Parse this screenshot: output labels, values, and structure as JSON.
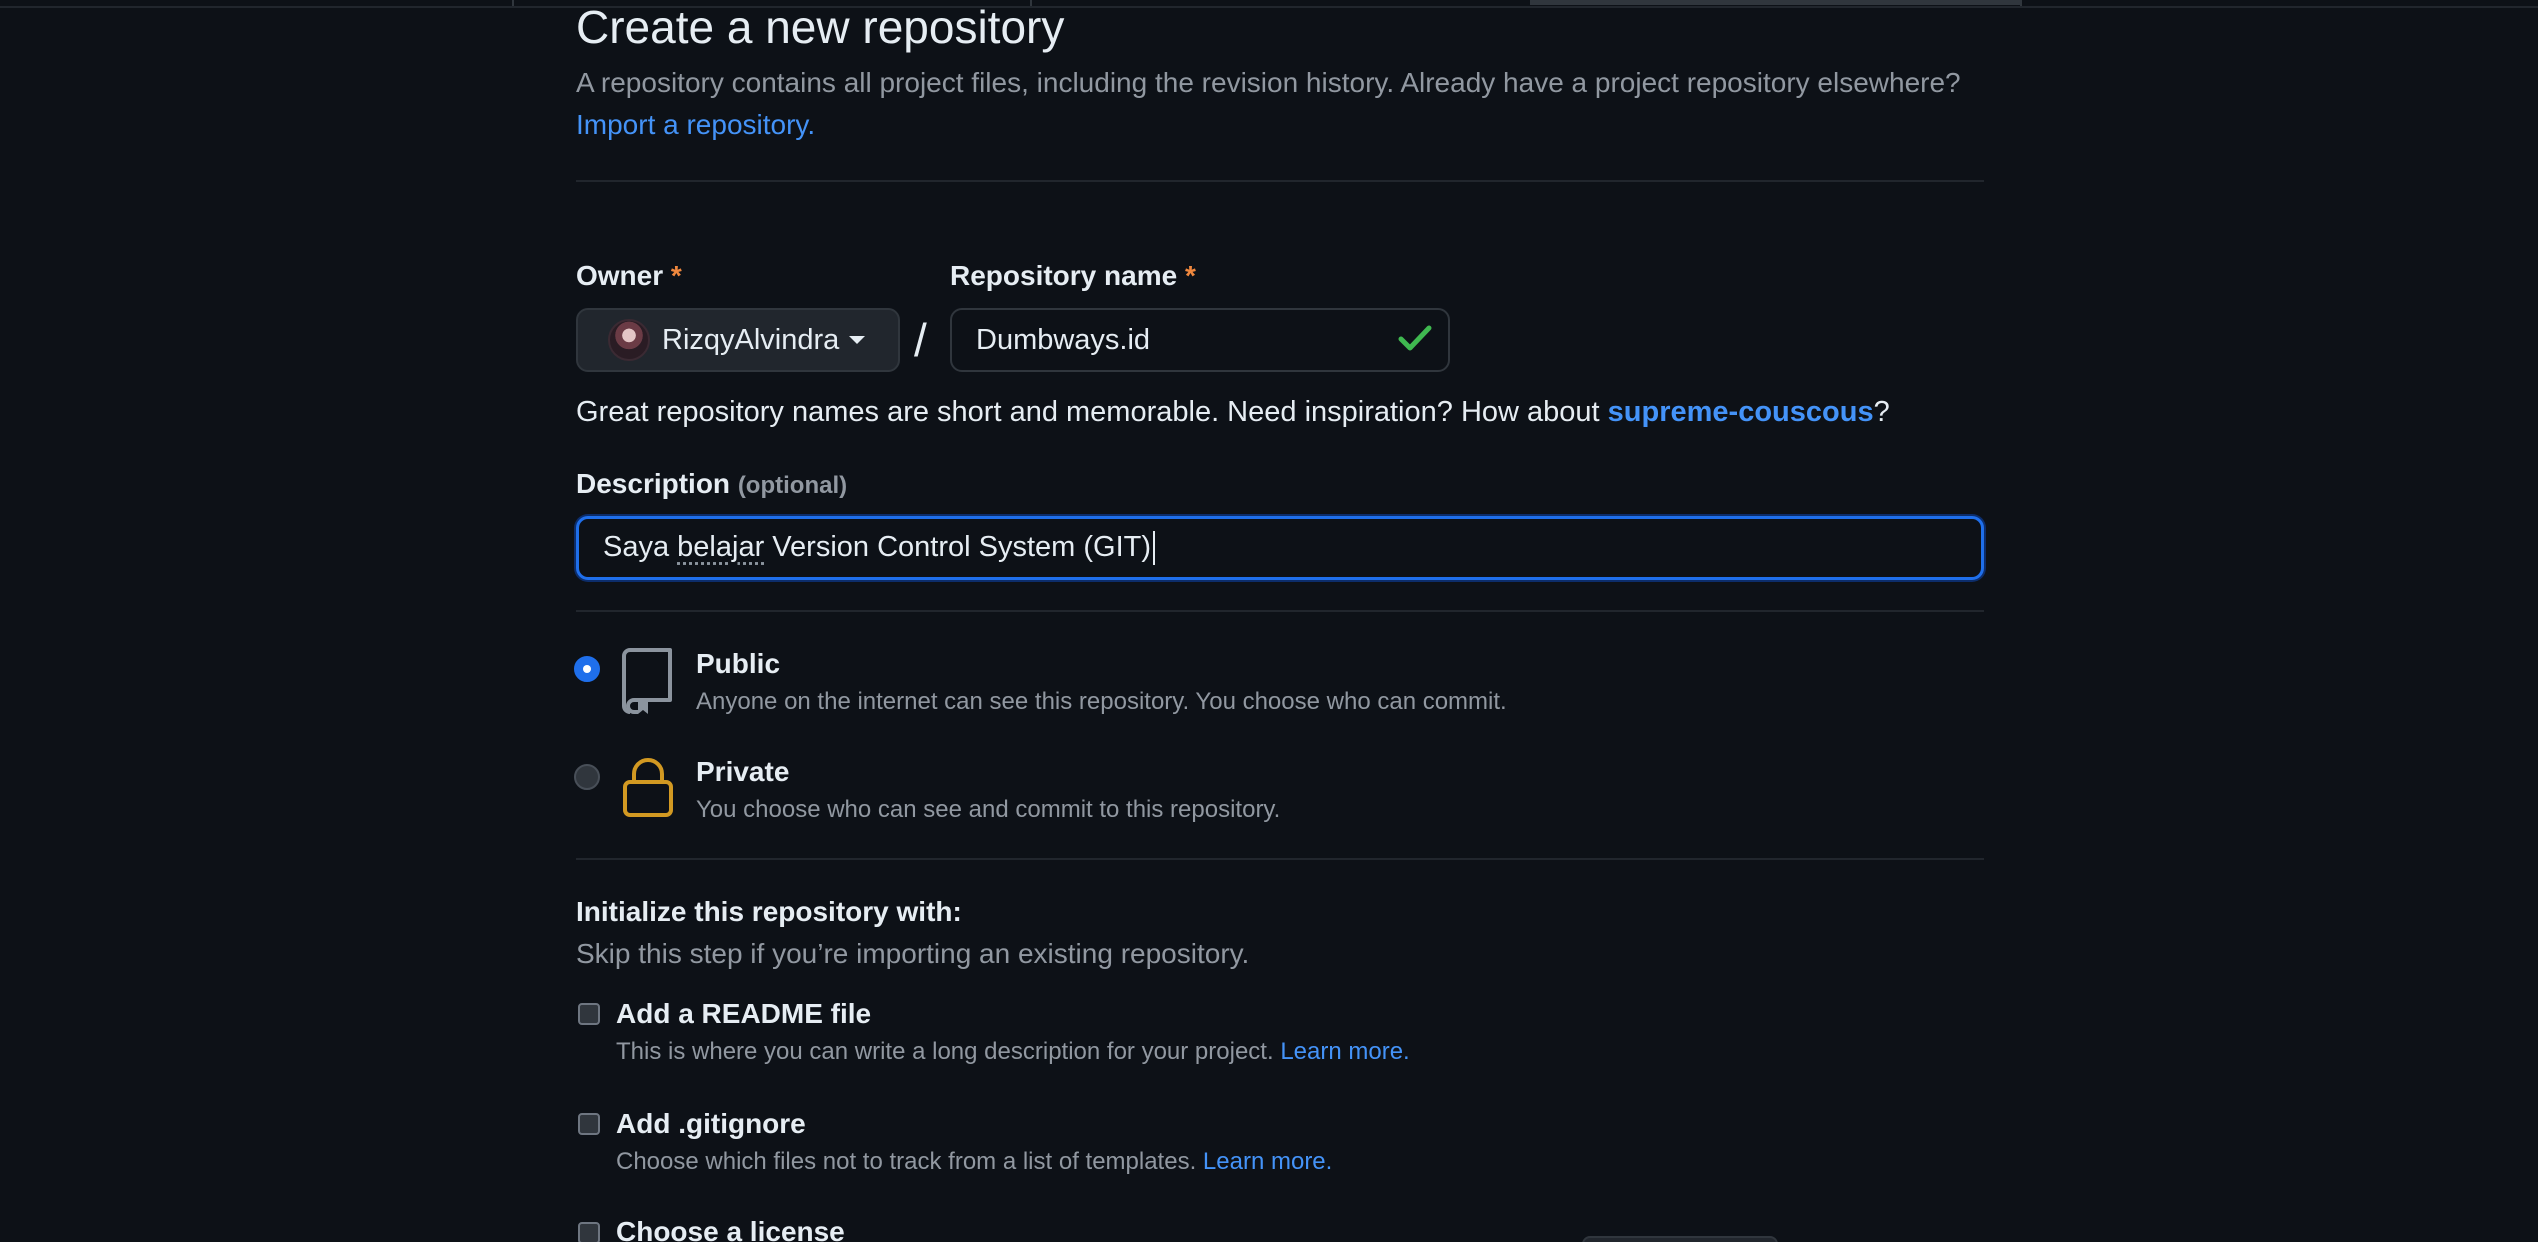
{
  "page": {
    "title": "Create a new repository",
    "subtitle_text": "A repository contains all project files, including the revision history. Already have a project repository elsewhere?",
    "import_link": "Import a repository."
  },
  "owner": {
    "label": "Owner",
    "required_mark": "*",
    "value": "RizqyAlvindra"
  },
  "repo_name": {
    "label": "Repository name",
    "required_mark": "*",
    "value": "Dumbways.id",
    "separator": "/"
  },
  "name_hint": {
    "text": "Great repository names are short and memorable. Need inspiration? How about",
    "suggestion": "supreme-couscous",
    "suffix": "?"
  },
  "description": {
    "label": "Description",
    "optional": "(optional)",
    "value_part1": "Saya ",
    "value_misspelled": "belajar",
    "value_part2": " Version Control System (GIT)"
  },
  "visibility": {
    "public": {
      "title": "Public",
      "desc": "Anyone on the internet can see this repository. You choose who can commit.",
      "selected": true,
      "icon": "repo-icon"
    },
    "private": {
      "title": "Private",
      "desc": "You choose who can see and commit to this repository.",
      "selected": false,
      "icon": "lock-icon"
    }
  },
  "initialize": {
    "title": "Initialize this repository with:",
    "subtitle": "Skip this step if you’re importing an existing repository.",
    "options": [
      {
        "title": "Add a README file",
        "desc": "This is where you can write a long description for your project.",
        "link": "Learn more.",
        "checked": false
      },
      {
        "title": "Add .gitignore",
        "desc": "Choose which files not to track from a list of templates.",
        "link": "Learn more.",
        "checked": false
      },
      {
        "title": "Choose a license",
        "checked": false
      }
    ]
  },
  "colors": {
    "background": "#0d1117",
    "accent": "#1f6feb",
    "link": "#4493f8",
    "success": "#3fb950",
    "lock": "#d29922"
  }
}
